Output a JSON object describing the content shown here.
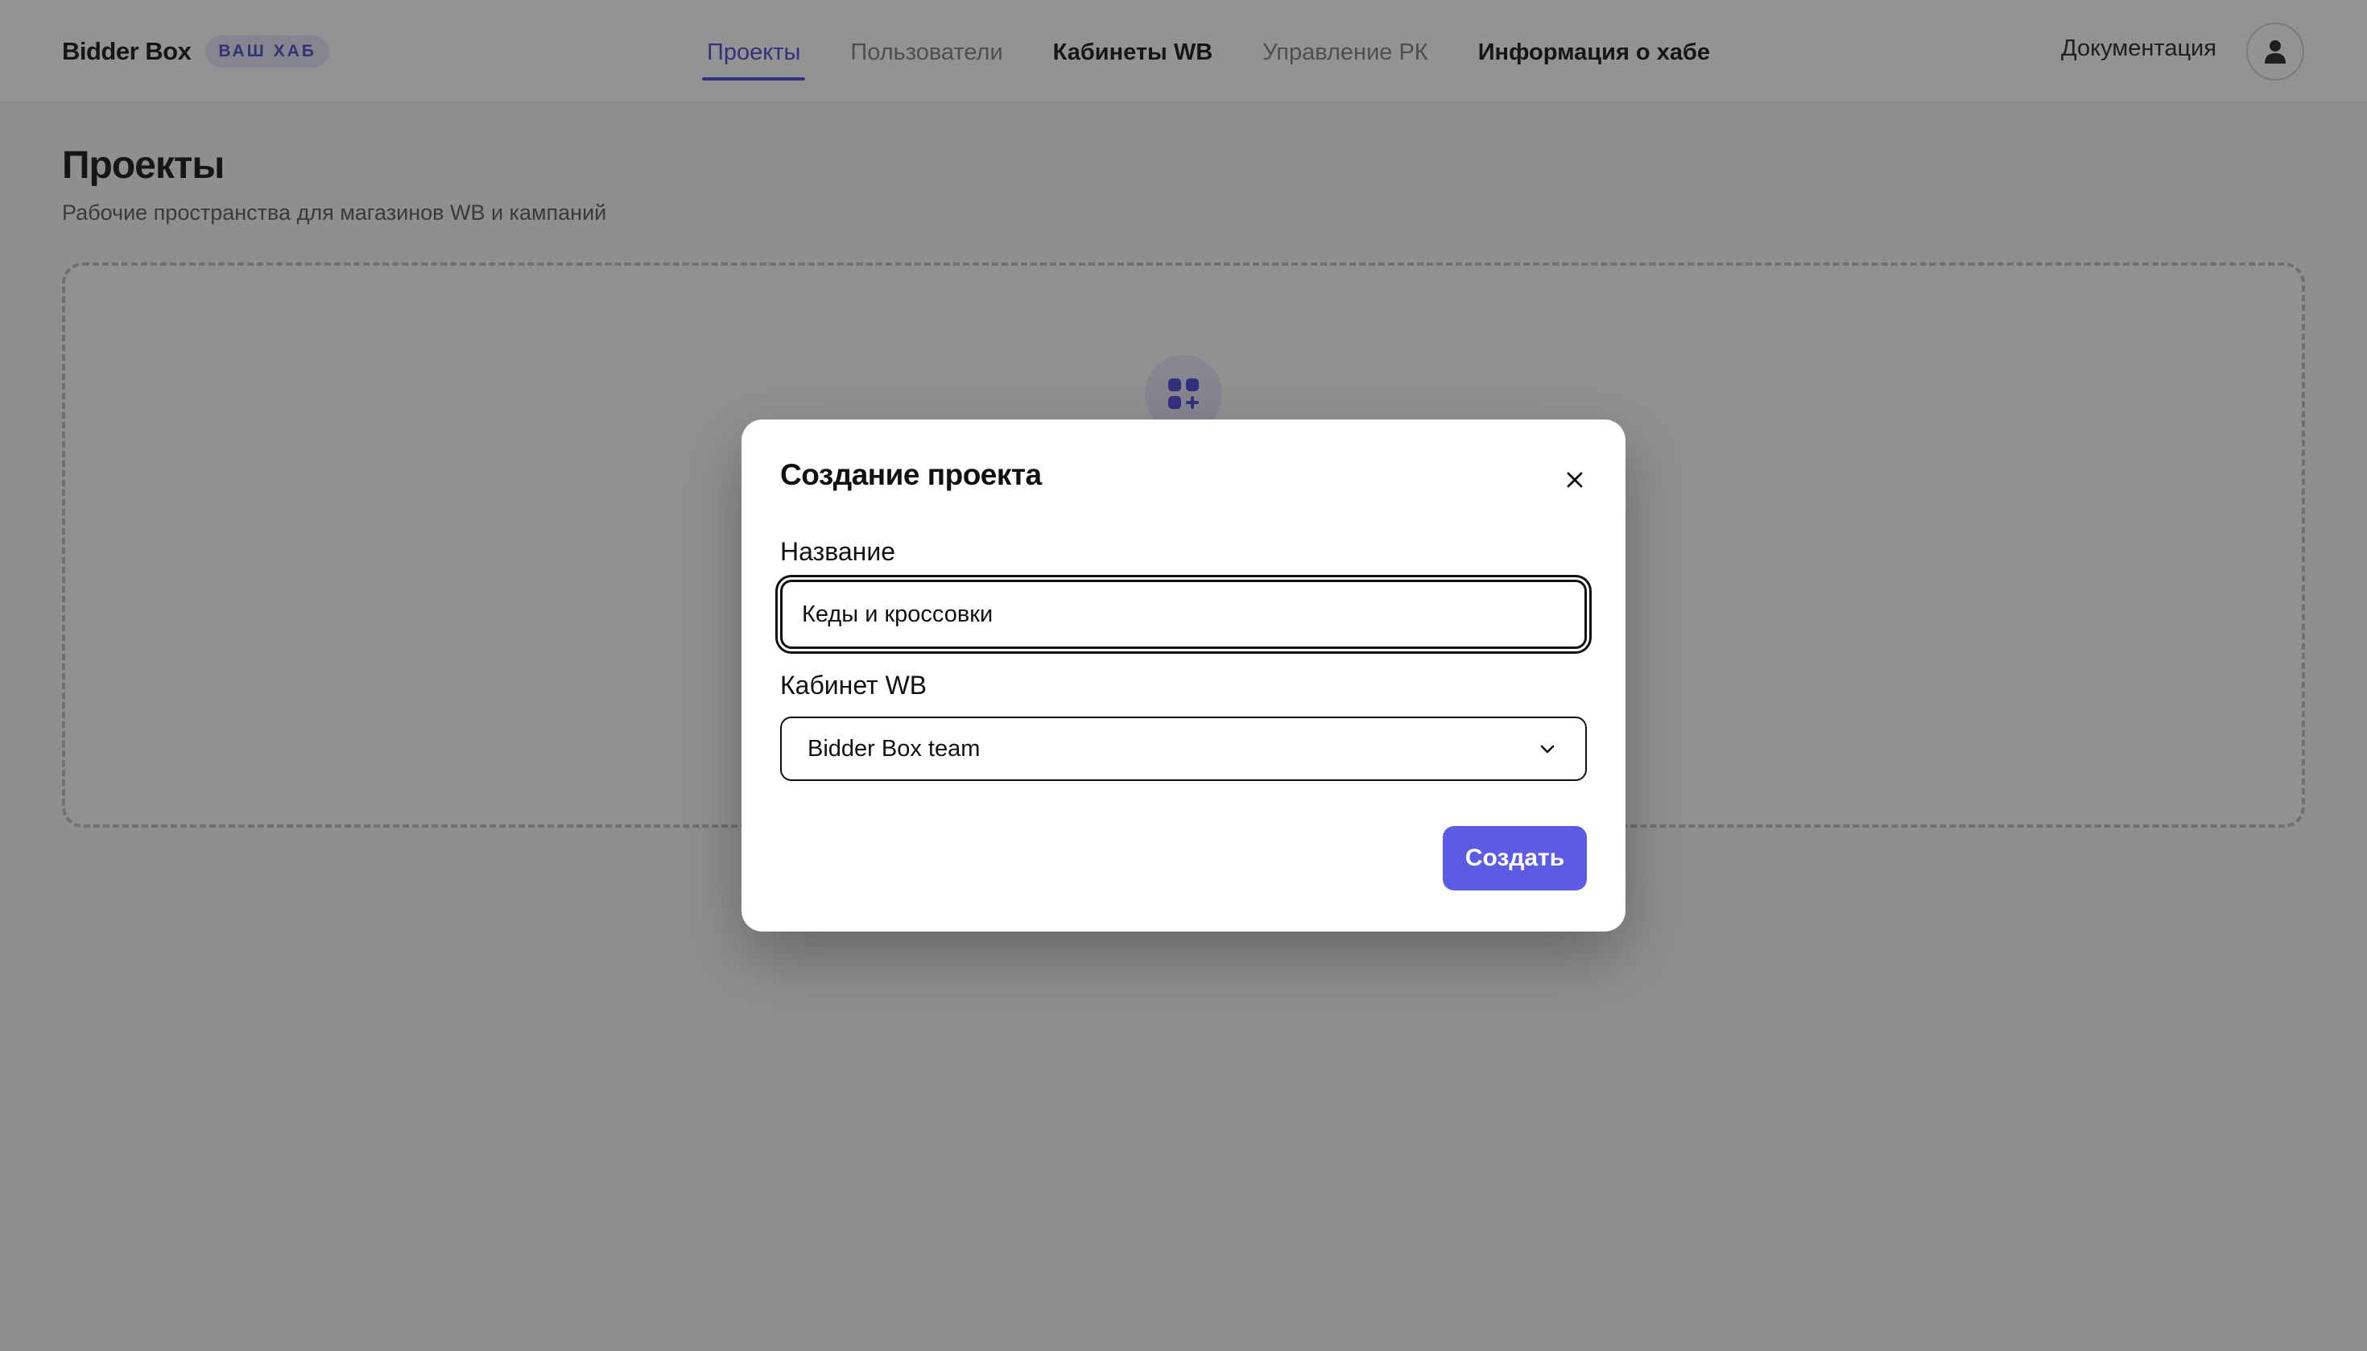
{
  "header": {
    "brand": "Bidder Box",
    "badge": "ВАШ ХАБ",
    "nav": [
      {
        "label": "Проекты",
        "state": "active"
      },
      {
        "label": "Пользователи",
        "state": "muted"
      },
      {
        "label": "Кабинеты WB",
        "state": "normal"
      },
      {
        "label": "Управление РК",
        "state": "muted"
      },
      {
        "label": "Информация о хабе",
        "state": "normal"
      }
    ],
    "docs": "Документация",
    "avatar_icon": "user-icon"
  },
  "page": {
    "title": "Проекты",
    "subtitle": "Рабочие пространства для магазинов WB и кампаний",
    "empty_icon": "add-grid-icon"
  },
  "modal": {
    "title": "Создание проекта",
    "close_icon": "close-icon",
    "name_label": "Название",
    "name_value": "Кеды и кроссовки",
    "cabinet_label": "Кабинет WB",
    "cabinet_value": "Bidder Box team",
    "chevron_icon": "chevron-down-icon",
    "submit": "Создать"
  },
  "colors": {
    "accent": "#5b5be6",
    "nav_active": "#4a43d6",
    "overlay": "rgba(30,30,30,0.48)"
  }
}
